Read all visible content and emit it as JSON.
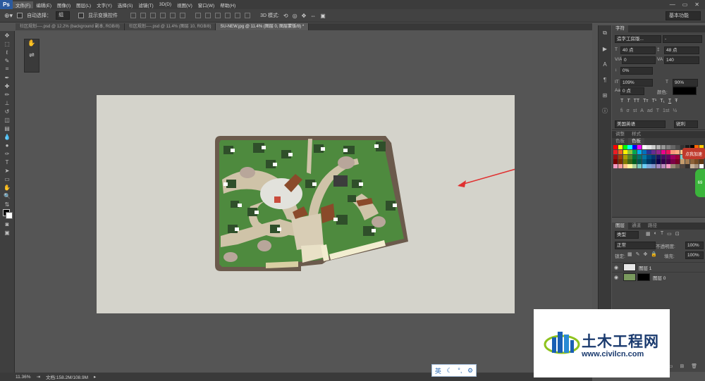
{
  "menubar": {
    "logo": "Ps",
    "items": [
      "文件(F)",
      "编辑(E)",
      "图像(I)",
      "图层(L)",
      "文字(Y)",
      "选择(S)",
      "滤镜(T)",
      "3D(D)",
      "视图(V)",
      "窗口(W)",
      "帮助(H)"
    ],
    "window_controls": [
      "—",
      "▭",
      "✕"
    ]
  },
  "options_bar": {
    "auto_select_label": "自动选择：",
    "auto_select_value": "组",
    "show_transform_label": "显示变换控件",
    "mode_3d_label": "3D 模式:",
    "workspace": "基本功能"
  },
  "tabs": [
    {
      "label": "社区规划----.psd @ 12.2% (background 副本, RGB/8)"
    },
    {
      "label": "社区规划----.psd @ 11.4% (图层 10, RGB/8)"
    },
    {
      "label": "SU-NEW.jpg @ 11.4% (图层 0, 图层蒙版/8) *"
    }
  ],
  "status": {
    "zoom": "11.36%",
    "doc_info": "文档:158.2M/108.9M"
  },
  "char_panel": {
    "tab": "字符",
    "font_family": "造字工房版...",
    "font_style": "-",
    "font_size": "40 点",
    "leading": "48 点",
    "kerning": "0",
    "tracking": "140",
    "vscale_pct": "0%",
    "vert_scale": "109%",
    "horiz_scale": "90%",
    "baseline": "0 点",
    "color_label": "颜色:",
    "style_glyphs": [
      "T",
      "T",
      "TT",
      "Tт",
      "T¹",
      "T₁",
      "T",
      "Ŧ"
    ],
    "ot_glyphs": [
      "fi",
      "σ",
      "st",
      "A",
      "ad",
      "T",
      "1st",
      "½"
    ],
    "language": "美国英语",
    "antialias": "锐利"
  },
  "swatch_panel": {
    "tabs": [
      "调整",
      "样式"
    ],
    "subtabs": [
      "色板",
      "色板"
    ],
    "colors": [
      "#ff0000",
      "#ffff00",
      "#00ff00",
      "#00ffff",
      "#0000ff",
      "#ff00ff",
      "#ffffff",
      "#e6e6e6",
      "#cccccc",
      "#b3b3b3",
      "#999999",
      "#808080",
      "#666666",
      "#4d4d4d",
      "#333333",
      "#1a1a1a",
      "#000000",
      "#ff6600",
      "#ffcc00",
      "#ed1c24",
      "#f26522",
      "#fff200",
      "#8dc63f",
      "#00a651",
      "#00aeef",
      "#0072bc",
      "#2e3192",
      "#662d91",
      "#92278f",
      "#ec008c",
      "#ed145b",
      "#f7977a",
      "#fbad82",
      "#fdc689",
      "#fff79a",
      "#c4df9b",
      "#a3d39c",
      "#82ca9d",
      "#9e0b0f",
      "#a0410d",
      "#aba000",
      "#598527",
      "#007236",
      "#00746b",
      "#0076a3",
      "#004b80",
      "#003471",
      "#1b1464",
      "#440e62",
      "#630460",
      "#9e005d",
      "#9e0039",
      "#7accc8",
      "#6dcff6",
      "#7da7d9",
      "#8393ca",
      "#8781bd",
      "#790000",
      "#7b2e00",
      "#827b00",
      "#406618",
      "#005e20",
      "#005952",
      "#005b7f",
      "#003663",
      "#002157",
      "#0d004c",
      "#32004b",
      "#4b0049",
      "#7b0046",
      "#7a0026",
      "#c69c6d",
      "#a67c52",
      "#8c6239",
      "#754c24",
      "#603913",
      "#f49ac1",
      "#f6989d",
      "#fdc68a",
      "#fff799",
      "#abd19a",
      "#79cbbd",
      "#6ccff6",
      "#7ea7d8",
      "#8393ca",
      "#a186be",
      "#bd8cbf",
      "#f49ac2",
      "#998675",
      "#736357",
      "#534741",
      "#362f2d",
      "#c7b299",
      "#a2907d",
      "#ffffff"
    ]
  },
  "promo_text": "点我加速",
  "badge_text": "69",
  "layers_panel": {
    "tabs": [
      "图层",
      "通道",
      "路径"
    ],
    "filter_kind": "类型",
    "blend_mode": "正常",
    "opacity_label": "不透明度:",
    "opacity": "100%",
    "lock_label": "锁定:",
    "fill_label": "填充:",
    "fill": "100%",
    "layers": [
      {
        "name": "图层 1"
      },
      {
        "name": "图层 0"
      }
    ]
  },
  "ime_bar": {
    "lang": "英",
    "items": [
      "☾",
      "°,",
      "⚙"
    ]
  },
  "watermark": {
    "title": "土木工程网",
    "url": "www.civilcn.com"
  },
  "colors": {
    "arrow": "#e03030",
    "canvas_bg": "#d4d3cb",
    "grass": "#4e8a3e",
    "path": "#cfc3a8",
    "border": "#6b5a4c"
  }
}
